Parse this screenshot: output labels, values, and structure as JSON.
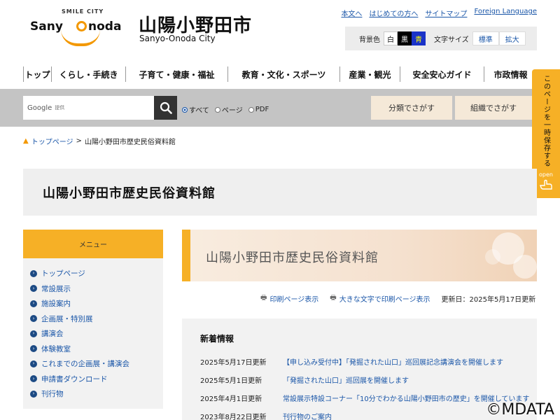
{
  "header": {
    "logo_smile_text": "SMILE CITY",
    "logo_left": "Sany",
    "logo_right": "noda",
    "site_name_jp": "山陽小野田市",
    "site_name_en": "Sanyo-Onoda City",
    "util_links": [
      "本文へ",
      "はじめての方へ",
      "サイトマップ",
      "Foreign Language"
    ],
    "display": {
      "bg_label": "背景色",
      "bg_white": "白",
      "bg_black": "黒",
      "bg_blue": "青",
      "size_label": "文字サイズ",
      "size_standard": "標準",
      "size_large": "拡大"
    }
  },
  "nav": {
    "items": [
      "トップ",
      "くらし・手続き",
      "子育て・健康・福祉",
      "教育・文化・スポーツ",
      "産業・観光",
      "安全安心ガイド",
      "市政情報"
    ]
  },
  "search": {
    "brand": "Google",
    "provided": "提供",
    "options": [
      "すべて",
      "ページ",
      "PDF"
    ],
    "category_button": "分類でさがす",
    "org_button": "組織でさがす"
  },
  "side_tab": {
    "text": "このページを一時保存する",
    "open": "open"
  },
  "breadcrumb": {
    "home": "トップページ",
    "separator": ">",
    "current": "山陽小野田市歴史民俗資料館"
  },
  "page_title": "山陽小野田市歴史民俗資料館",
  "menu": {
    "header": "メニュー",
    "items": [
      "トップページ",
      "常設展示",
      "施設案内",
      "企画展・特別展",
      "講演会",
      "体験教室",
      "これまでの企画展・講演会",
      "申請書ダウンロード",
      "刊行物"
    ]
  },
  "banner_title": "山陽小野田市歴史民俗資料館",
  "print": {
    "print_link": "印刷ページ表示",
    "large_print_link": "大きな文字で印刷ページ表示",
    "updated": "更新日：2025年5月17日更新"
  },
  "news": {
    "title": "新着情報",
    "items": [
      {
        "date": "2025年5月17日更新",
        "text": "【申し込み受付中】「発掘された山口」巡回展記念講演会を開催します"
      },
      {
        "date": "2025年5月1日更新",
        "text": "「発掘された山口」巡回展を開催します"
      },
      {
        "date": "2025年4月1日更新",
        "text": "常設展示特設コーナー「10分でわかる山陽小野田市の歴史」を開催しています"
      },
      {
        "date": "2023年8月22日更新",
        "text": "刊行物のご案内"
      }
    ]
  },
  "watermark": "©MDATA"
}
